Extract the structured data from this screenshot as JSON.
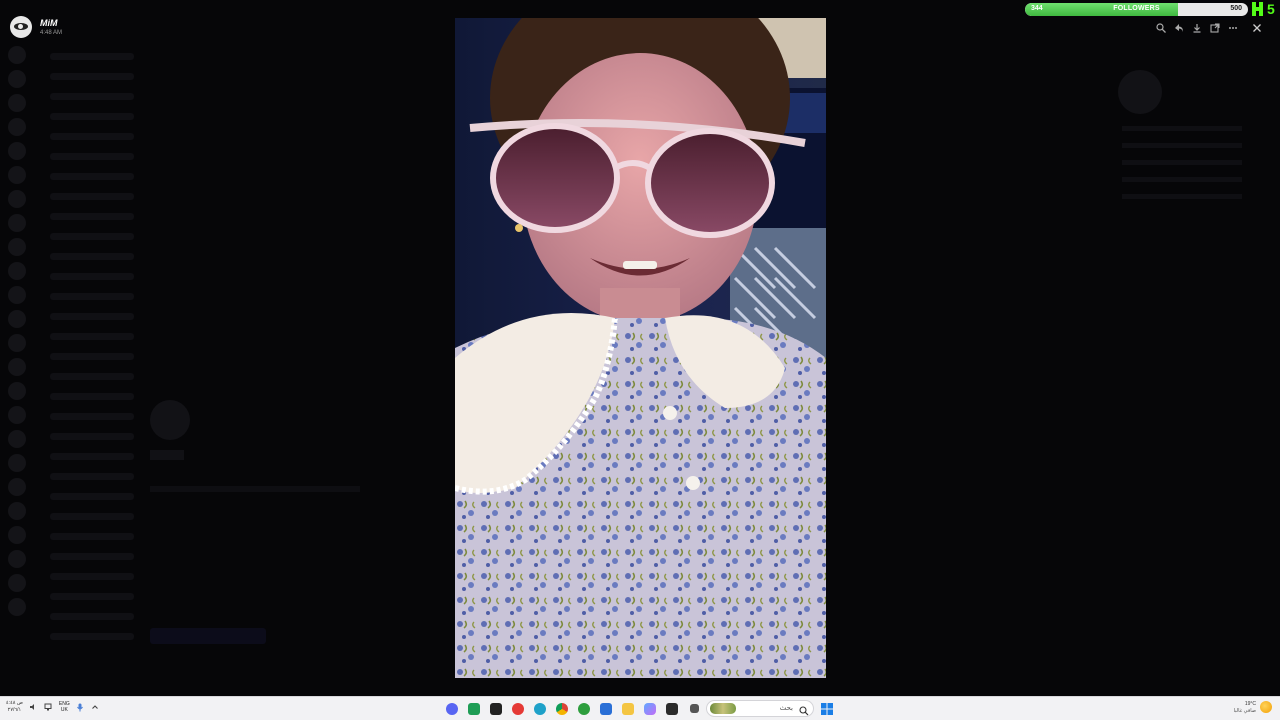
{
  "user": {
    "name": "MiM",
    "time": "4:48 AM"
  },
  "photo": {
    "subject": "girl-in-sunglasses-photo"
  },
  "followers": {
    "current": "344",
    "label": "FOLLOWERS",
    "goal": "500",
    "progress": 0.688,
    "fill_color": "#4cc94c"
  },
  "kick": {
    "count": "5",
    "color": "#53fc18"
  },
  "viewer_toolbar": {
    "buttons": [
      "zoom-icon",
      "reply-icon",
      "download-icon",
      "open-external-icon",
      "more-icon"
    ],
    "close": "close-icon"
  },
  "taskbar": {
    "date": "٢٧/٦/١",
    "language_line1": "ENG",
    "language_line2": "UK",
    "search_text": "بحث",
    "weather_temp": "19°C",
    "weather_text": "صافي غالبا"
  }
}
